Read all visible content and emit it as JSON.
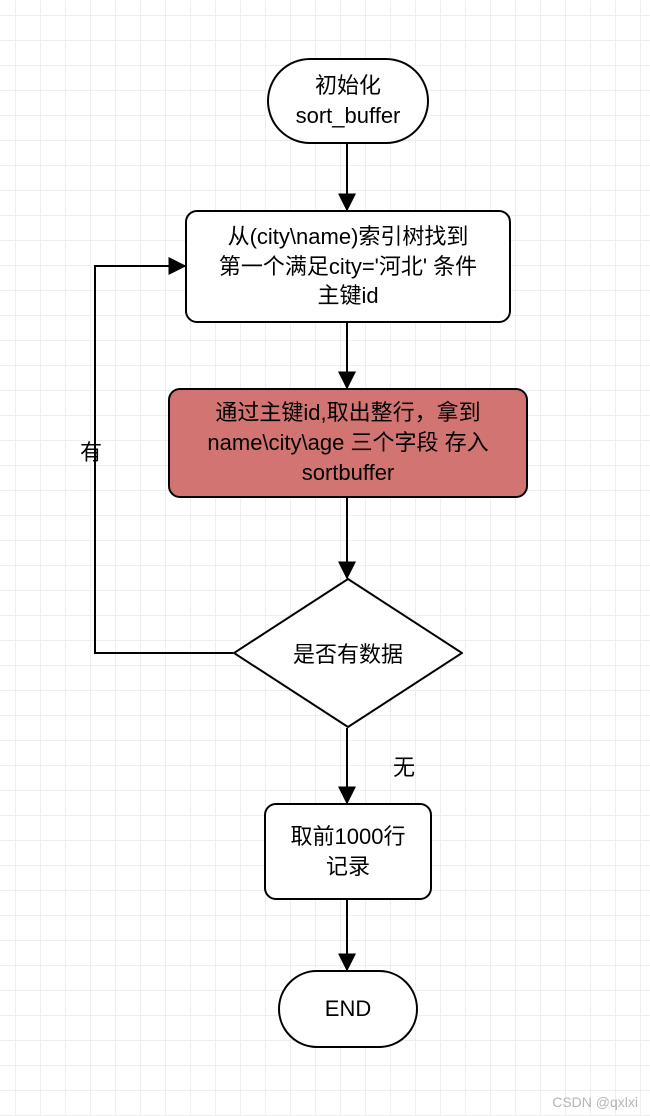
{
  "nodes": {
    "start": {
      "line1": "初始化",
      "line2": "sort_buffer"
    },
    "findIndex": "从(city\\name)索引树找到\n第一个满足city='河北' 条件\n主键id",
    "fetchRow": "通过主键id,取出整行，拿到\nname\\city\\age 三个字段 存入\nsortbuffer",
    "decision": "是否有数据",
    "top1000": {
      "line1": "取前1000行",
      "line2": "记录"
    },
    "end": "END"
  },
  "edges": {
    "yes": "有",
    "no": "无"
  },
  "watermark": "CSDN @qxlxi",
  "colors": {
    "highlight": "#d27471"
  }
}
